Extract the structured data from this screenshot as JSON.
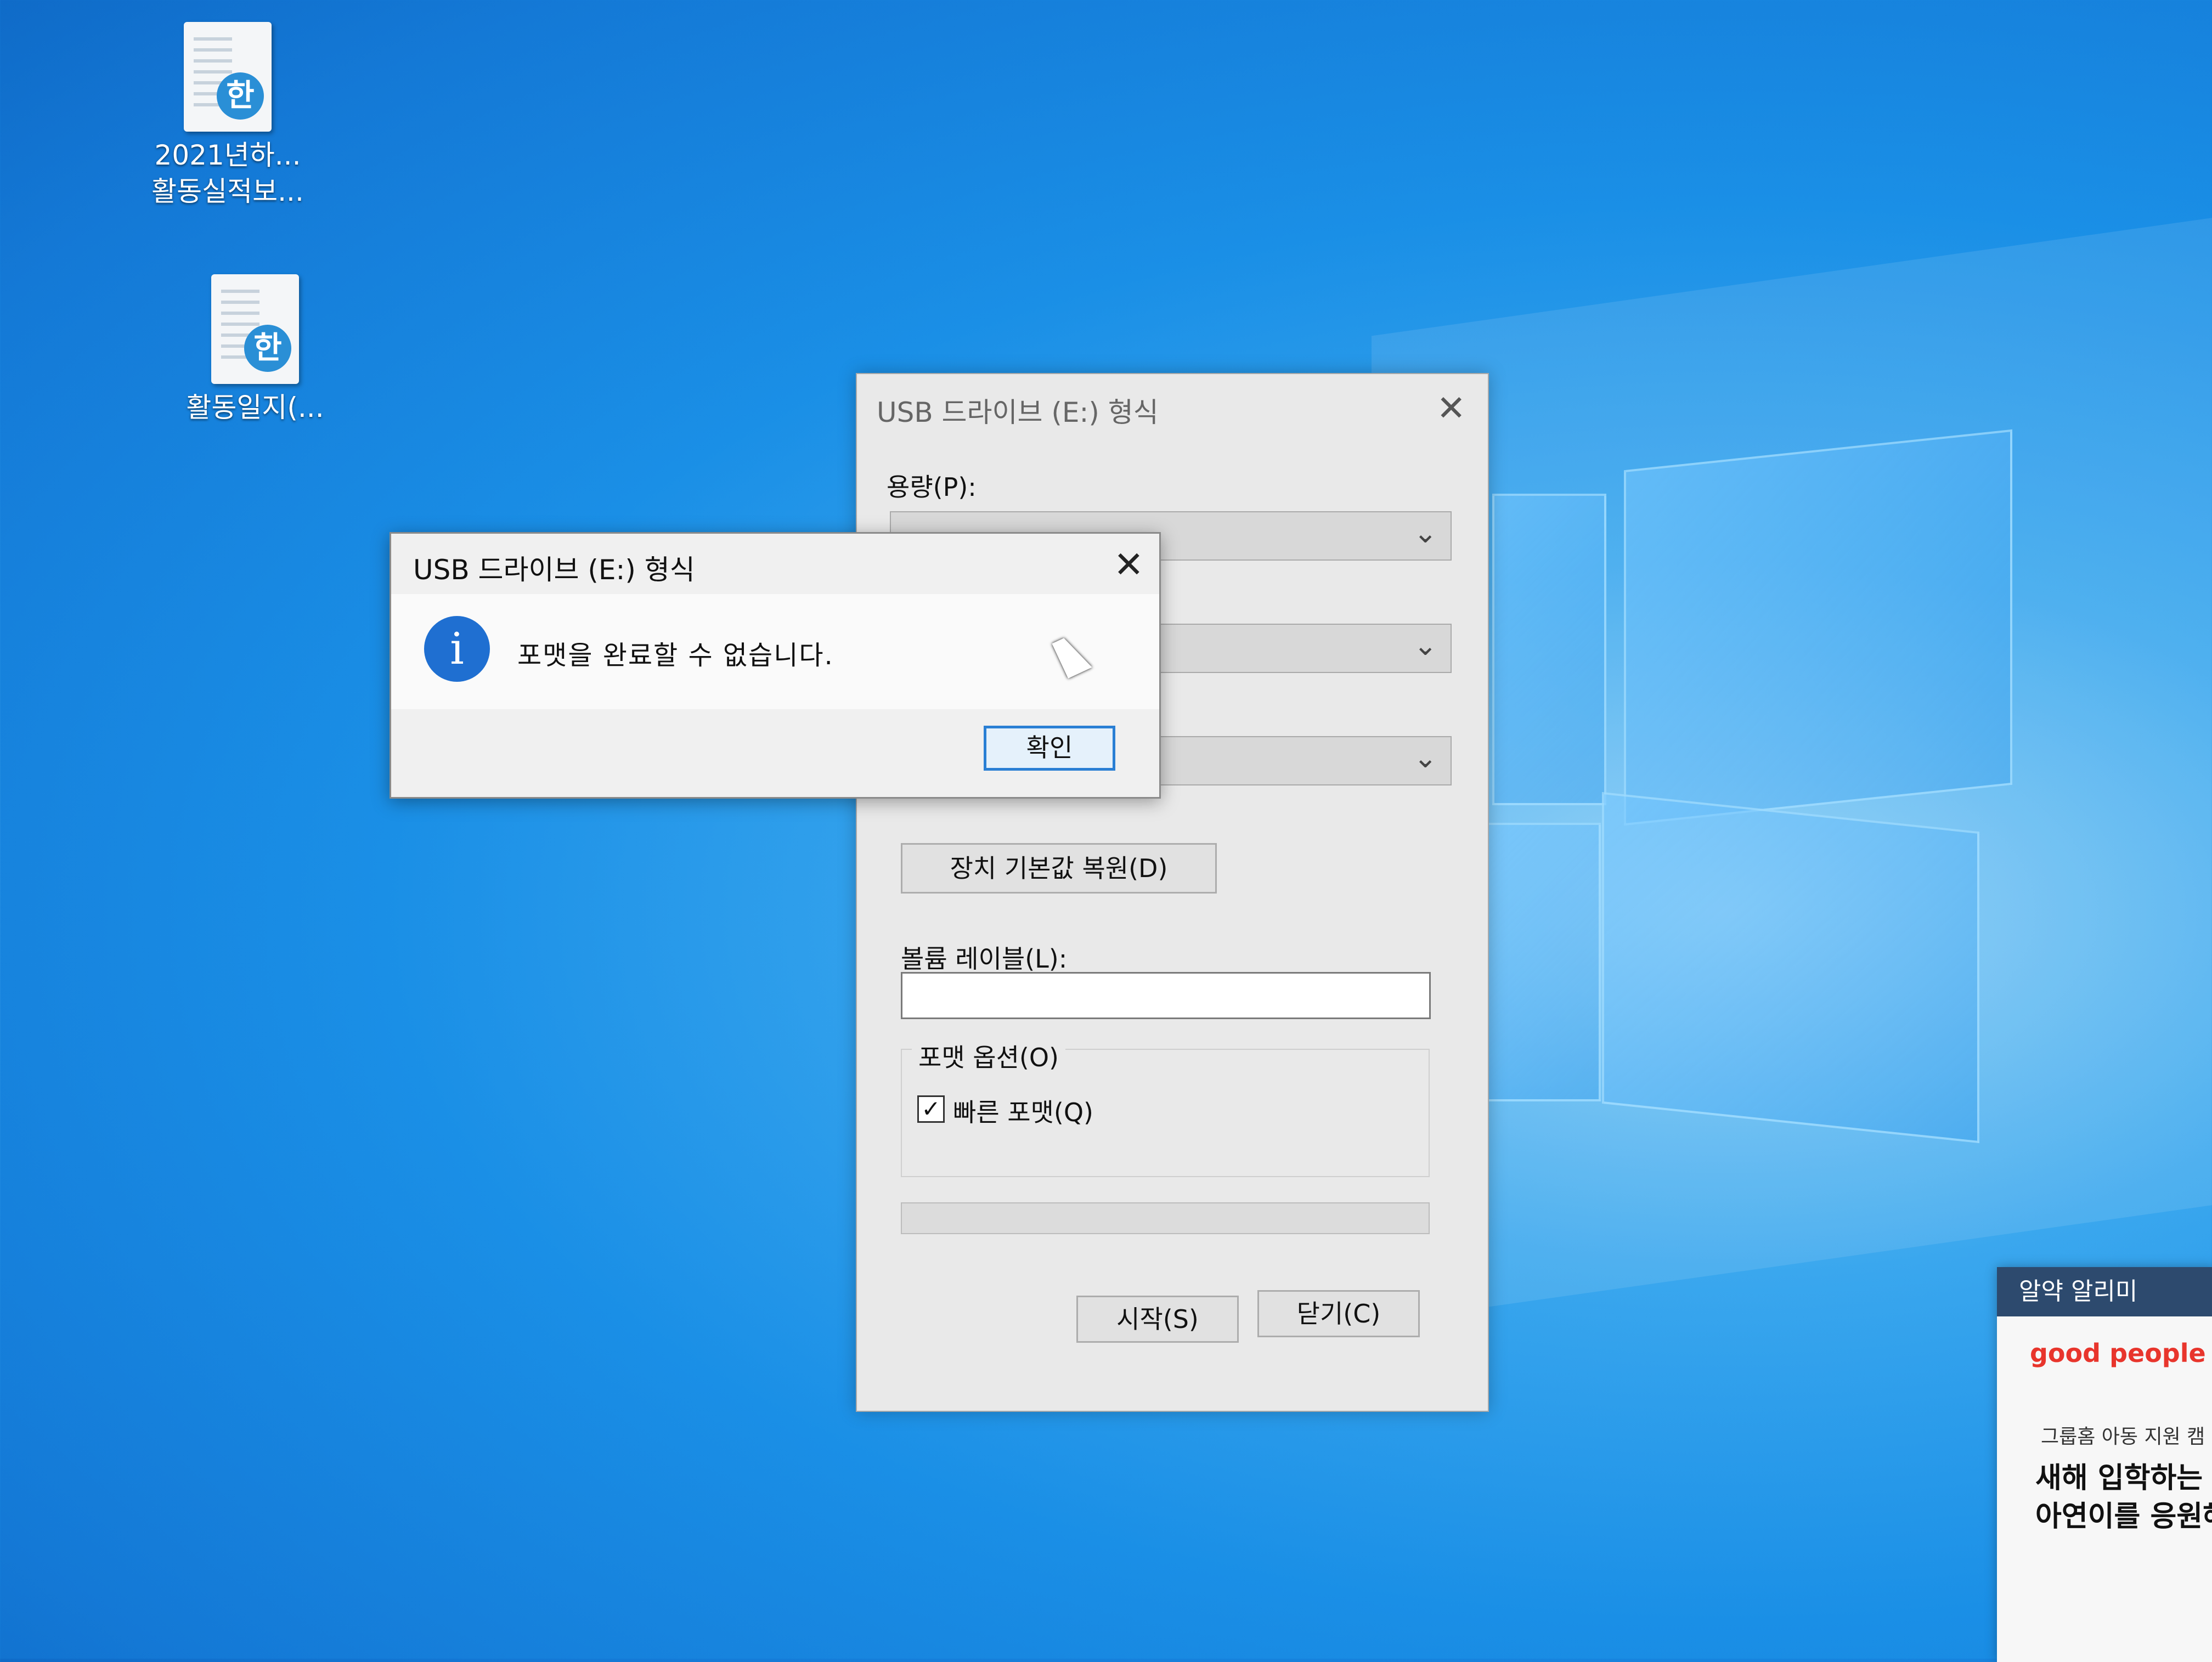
{
  "desktop": {
    "icons": [
      {
        "label_line1": "2021년하...",
        "label_line2": "활동실적보...",
        "badge": "한"
      },
      {
        "label_line1": "활동일지(...",
        "badge": "한"
      }
    ]
  },
  "format_dialog": {
    "title": "USB 드라이브 (E:) 형식",
    "capacity_label": "용량(P):",
    "restore_defaults_label": "장치 기본값 복원(D)",
    "volume_label_label": "볼륨 레이블(L):",
    "volume_label_value": "",
    "format_options_label": "포맷 옵션(O)",
    "quick_format_label": "빠른 포맷(Q)",
    "quick_format_checked": true,
    "start_label": "시작(S)",
    "close_label": "닫기(C)"
  },
  "message_box": {
    "title": "USB 드라이브 (E:) 형식",
    "message": "포맷을 완료할 수 없습니다.",
    "ok_label": "확인",
    "icon": "info-icon"
  },
  "notification": {
    "header": "알약 알리미",
    "brand": "good people",
    "subtitle": "그룹홈 아동 지원 캠",
    "headline_line1": "새해 입학하는",
    "headline_line2": "아연이를 응원해"
  }
}
